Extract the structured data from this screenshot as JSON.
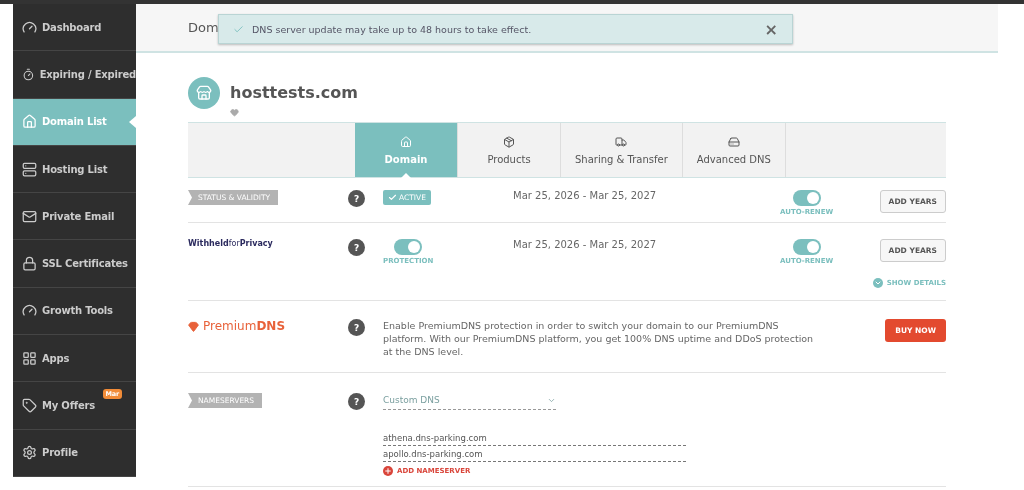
{
  "sidebar": {
    "items": [
      {
        "label": "Dashboard",
        "selected": false
      },
      {
        "label": "Expiring / Expired",
        "selected": false
      },
      {
        "label": "Domain List",
        "selected": true
      },
      {
        "label": "Hosting List",
        "selected": false
      },
      {
        "label": "Private Email",
        "selected": false
      },
      {
        "label": "SSL Certificates",
        "selected": false
      },
      {
        "label": "Growth Tools",
        "selected": false
      },
      {
        "label": "Apps",
        "selected": false
      },
      {
        "label": "My Offers",
        "selected": false,
        "badge": "Mar"
      },
      {
        "label": "Profile",
        "selected": false
      }
    ]
  },
  "header": {
    "title": "Dom"
  },
  "toast": {
    "message": "DNS server update may take up to 48 hours to take effect.",
    "close": "×"
  },
  "domain": {
    "name": "hosttests.com"
  },
  "tabs": [
    {
      "label": "Domain",
      "selected": true
    },
    {
      "label": "Products",
      "selected": false
    },
    {
      "label": "Sharing & Transfer",
      "selected": false
    },
    {
      "label": "Advanced DNS",
      "selected": false
    }
  ],
  "rows": [
    {
      "kind": "status",
      "label": "STATUS & VALIDITY",
      "help": "?",
      "status": "ACTIVE",
      "dates": "Mar 25, 2026 - Mar 25, 2027",
      "auto_renew": {
        "label": "AUTO-RENEW",
        "on": true
      },
      "button": "ADD YEARS"
    },
    {
      "kind": "privacy",
      "logo": "**Withheld**for**Privacy**",
      "help": "?",
      "protection": {
        "label": "PROTECTION",
        "on": true
      },
      "dates": "Mar 25, 2026 - Mar 25, 2027",
      "auto_renew": {
        "label": "AUTO-RENEW",
        "on": true
      },
      "button": "ADD YEARS",
      "details": "SHOW DETAILS"
    },
    {
      "kind": "premium",
      "logo": "Premium**DNS**",
      "help": "?",
      "description": "Enable PremiumDNS protection in order to switch your domain to our PremiumDNS platform. With our PremiumDNS platform, you get 100% DNS uptime and DDoS protection at the DNS level.",
      "button": "BUY NOW"
    },
    {
      "kind": "nameservers",
      "label": "NAMESERVERS",
      "help": "?",
      "select": "Custom DNS",
      "nameservers": [
        "athena.dns-parking.com",
        "apollo.dns-parking.com"
      ],
      "add": "ADD NAMESERVER"
    }
  ]
}
